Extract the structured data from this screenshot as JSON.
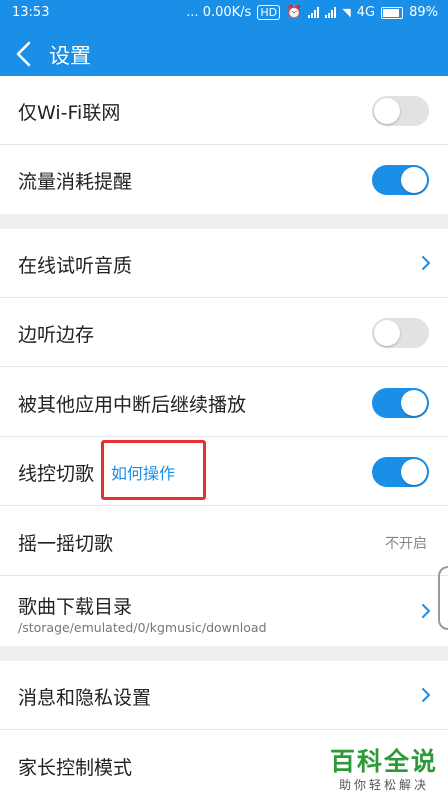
{
  "status_bar": {
    "time": "13:53",
    "network_speed": "... 0.00K/s",
    "network_type": "4G",
    "battery": "89%",
    "icons": [
      "hd-icon",
      "alarm-icon",
      "signal-icon",
      "signal-icon",
      "wifi-icon",
      "battery-icon"
    ]
  },
  "app_bar": {
    "title": "设置",
    "back_icon": "chevron-left-icon"
  },
  "settings": {
    "wifi_only": {
      "label": "仅Wi-Fi联网",
      "enabled": false
    },
    "data_usage_reminder": {
      "label": "流量消耗提醒",
      "enabled": true
    },
    "online_quality": {
      "label": "在线试听音质"
    },
    "listen_and_cache": {
      "label": "边听边存",
      "enabled": false
    },
    "resume_after_interrupt": {
      "label": "被其他应用中断后继续播放",
      "enabled": true
    },
    "wire_control": {
      "label": "线控切歌",
      "link": "如何操作",
      "enabled": true
    },
    "shake_switch": {
      "label": "摇一摇切歌",
      "value": "不开启"
    },
    "download_dir": {
      "label": "歌曲下载目录",
      "path": "/storage/emulated/0/kgmusic/download"
    },
    "privacy": {
      "label": "消息和隐私设置"
    },
    "parental": {
      "label": "家长控制模式"
    }
  },
  "watermark": {
    "title": "百科全说",
    "subtitle": "助你轻松解决"
  },
  "colors": {
    "accent": "#1a8fe8",
    "highlight_box": "#e53030",
    "watermark": "#2c9a38"
  }
}
